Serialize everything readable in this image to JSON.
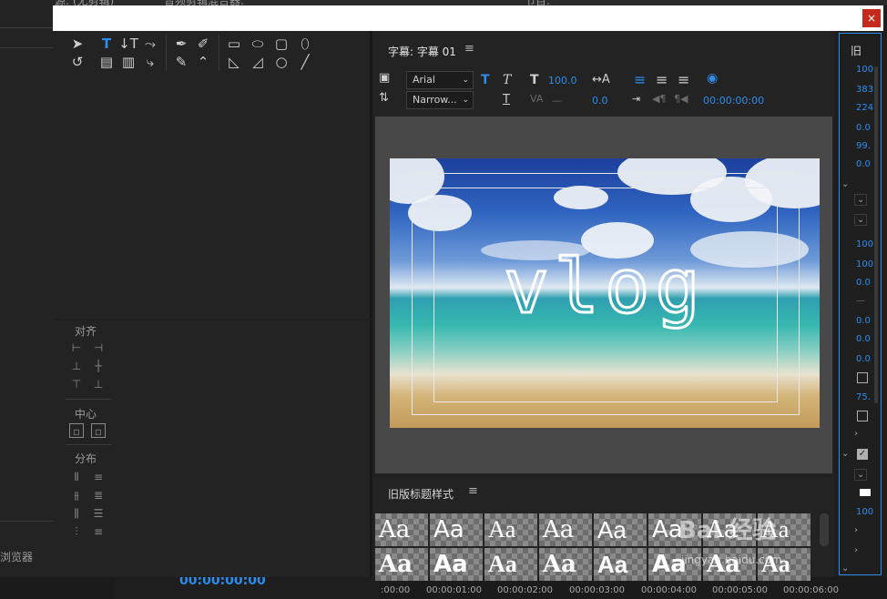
{
  "background_app": {
    "top_left_text": "视图",
    "top_mid_text_1": "源: (无剪辑)",
    "top_mid_text_2": "音频剪辑混合器:",
    "top_right_text": "节目:",
    "left_bottom_label": "浏览器",
    "sequence_timecode": "00:00:00:00"
  },
  "dialog": {
    "close_label": "×",
    "tools": {
      "align_label": "对齐",
      "center_label": "中心",
      "distribute_label": "分布"
    },
    "title_panel": {
      "tab_label": "字幕: 字幕 01",
      "menu_icon": "hamburger-icon",
      "font_family": "Arial",
      "font_style": "Narrow...",
      "font_size": "100.0",
      "kerning": "0.0",
      "leading_placeholder": "—",
      "timecode": "00:00:00:00",
      "canvas_text": "vlog"
    },
    "styles_panel": {
      "title": "旧版标题样式",
      "swatch_text": "Aa",
      "swatch_count": 16
    },
    "properties_panel": {
      "header": "旧",
      "values": [
        "100",
        "383",
        "224",
        "0.0",
        "99.",
        "0.0",
        "100",
        "100",
        "0.0",
        "—",
        "0.0",
        "0.0",
        "0.0",
        "75.",
        "100"
      ]
    }
  },
  "timeline": {
    "ticks": [
      ":00:00",
      "00:00:01:00",
      "00:00:02:00",
      "00:00:03:00",
      "00:00:04:00",
      "00:00:05:00",
      "00:00:06:00"
    ]
  },
  "watermark": {
    "brand": "Bai  经验",
    "url": "jingyan.baidu.com"
  },
  "colors": {
    "accent_blue": "#2d8ceb",
    "close_red": "#c42b1c",
    "panel_bg": "#232323"
  }
}
